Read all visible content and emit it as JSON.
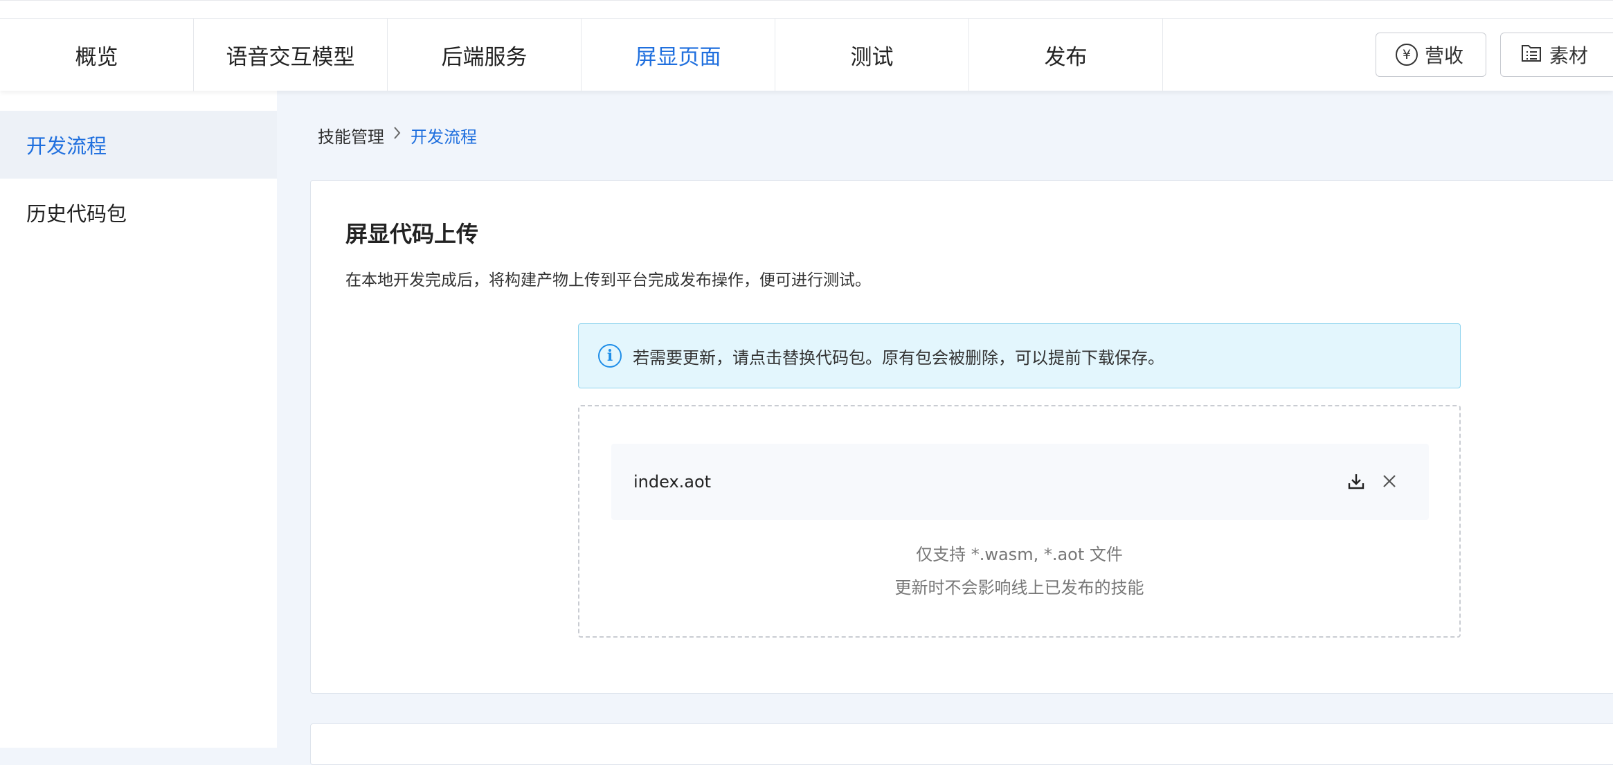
{
  "nav": {
    "tabs": [
      {
        "label": "概览"
      },
      {
        "label": "语音交互模型"
      },
      {
        "label": "后端服务"
      },
      {
        "label": "屏显页面",
        "active": true
      },
      {
        "label": "测试"
      },
      {
        "label": "发布"
      }
    ],
    "revenue_label": "营收",
    "material_label": "素材"
  },
  "sidebar": {
    "items": [
      {
        "label": "开发流程",
        "active": true
      },
      {
        "label": "历史代码包"
      }
    ]
  },
  "breadcrumb": {
    "parent": "技能管理",
    "current": "开发流程"
  },
  "card": {
    "title": "屏显代码上传",
    "description": "在本地开发完成后，将构建产物上传到平台完成发布操作，便可进行测试。",
    "notice": "若需要更新，请点击替换代码包。原有包会被删除，可以提前下载保存。",
    "file_name": "index.aot",
    "hint_formats": "仅支持 *.wasm, *.aot 文件",
    "hint_update": "更新时不会影响线上已发布的技能"
  },
  "colors": {
    "accent": "#1f6fde",
    "notice_bg": "#e3f6fd",
    "notice_border": "#8fd4ee"
  },
  "icons": [
    "yen-icon",
    "folder-list-icon",
    "chevron-right-icon",
    "info-icon",
    "download-icon",
    "close-icon"
  ]
}
